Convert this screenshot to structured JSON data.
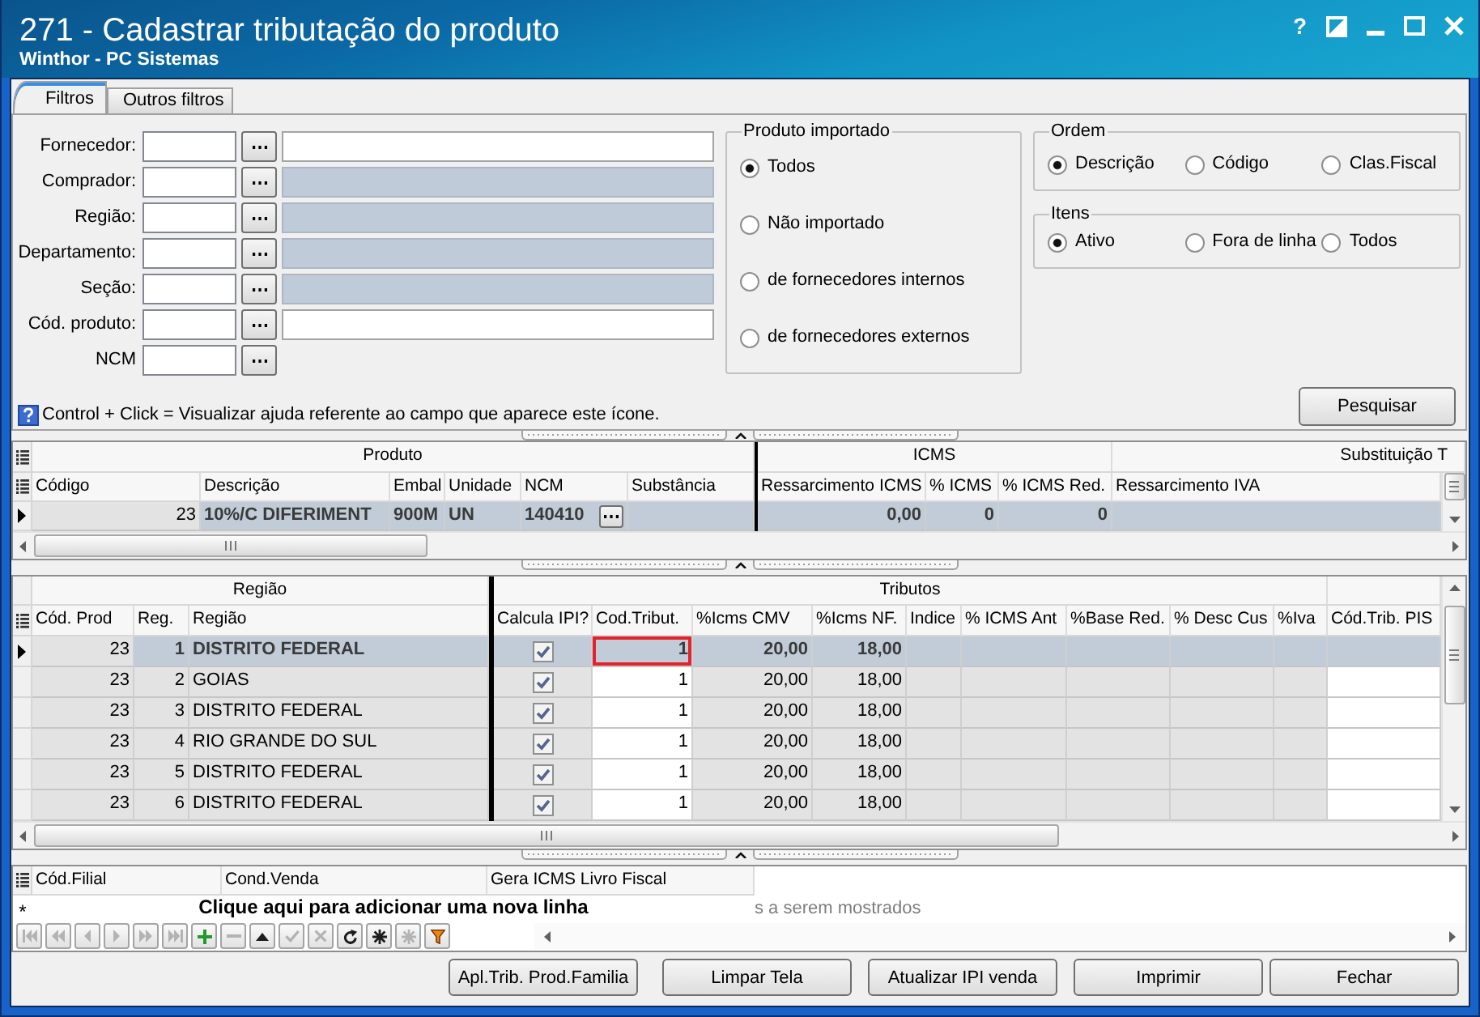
{
  "window": {
    "title": "271 - Cadastrar tributação do produto",
    "subtitle": "Winthor - PC Sistemas",
    "help_button": "?"
  },
  "tabs": [
    {
      "label": "Filtros",
      "selected": true
    },
    {
      "label": "Outros filtros",
      "selected": false
    }
  ],
  "filters": [
    {
      "label": "Fornecedor:",
      "kind": "lookup_description",
      "description_disabled": false
    },
    {
      "label": "Comprador:",
      "kind": "lookup_description",
      "description_disabled": true
    },
    {
      "label": "Região:",
      "kind": "lookup_description",
      "description_disabled": true
    },
    {
      "label": "Departamento:",
      "kind": "lookup_description",
      "description_disabled": true
    },
    {
      "label": "Seção:",
      "kind": "lookup_description",
      "description_disabled": true
    },
    {
      "label": "Cód. produto:",
      "kind": "lookup_description",
      "description_disabled": false
    },
    {
      "label": "NCM",
      "kind": "lookup"
    }
  ],
  "produto_importado": {
    "title": "Produto importado",
    "options": [
      {
        "label": "Todos",
        "selected": true
      },
      {
        "label": "Não importado",
        "selected": false
      },
      {
        "label": "de fornecedores internos",
        "selected": false
      },
      {
        "label": "de fornecedores externos",
        "selected": false
      }
    ]
  },
  "ordem": {
    "title": "Ordem",
    "options": [
      {
        "label": "Descrição",
        "selected": true
      },
      {
        "label": "Código",
        "selected": false
      },
      {
        "label": "Clas.Fiscal",
        "selected": false
      }
    ]
  },
  "itens": {
    "title": "Itens",
    "options": [
      {
        "label": "Ativo",
        "selected": true
      },
      {
        "label": "Fora de linha",
        "selected": false
      },
      {
        "label": "Todos",
        "selected": false
      }
    ]
  },
  "help_hint": "Control + Click = Visualizar ajuda referente ao campo que aparece este ícone.",
  "search_button": "Pesquisar",
  "product_grid": {
    "bands": [
      "Produto",
      "ICMS",
      "Substituição T"
    ],
    "columns": [
      "Código",
      "Descrição",
      "Embal",
      "Unidade",
      "NCM",
      "Substância",
      "Ressarcimento ICMS",
      "% ICMS",
      "% ICMS Red.",
      "Ressarcimento IVA"
    ],
    "rows": [
      {
        "selected": true,
        "codigo": "23",
        "descricao": "10%/C DIFERIMENT",
        "embalagem": "900M",
        "unidade": "UN",
        "ncm": "140410",
        "ressarcimento_icms": "0,00",
        "pct_icms": "0",
        "pct_icms_red": "0"
      }
    ]
  },
  "region_grid": {
    "bands": [
      "Região",
      "Tributos"
    ],
    "columns": [
      {
        "label": "Cód. Prod",
        "editable": false
      },
      {
        "label": "Reg.",
        "editable": false
      },
      {
        "label": "Região",
        "editable": false
      },
      {
        "label": "Calcula IPI?",
        "editable": false
      },
      {
        "label": "Cod.Tribut.",
        "editable": true
      },
      {
        "label": "%Icms CMV",
        "editable": false
      },
      {
        "label": "%Icms NF.",
        "editable": false
      },
      {
        "label": "Indice",
        "editable": false
      },
      {
        "label": "% ICMS Ant",
        "editable": false
      },
      {
        "label": "%Base Red.",
        "editable": false
      },
      {
        "label": "% Desc Cus",
        "editable": false
      },
      {
        "label": "%Iva",
        "editable": false
      },
      {
        "label": "Cód.Trib. PIS",
        "editable": true
      }
    ],
    "rows": [
      {
        "selected": true,
        "cod_prod": "23",
        "reg": "1",
        "regiao": "DISTRITO FEDERAL",
        "calcula_ipi_checked": true,
        "cod_tribut": "1",
        "cod_tribut_highlighted": true,
        "icms_cmv": "20,00",
        "icms_nf": "18,00"
      },
      {
        "selected": false,
        "cod_prod": "23",
        "reg": "2",
        "regiao": "GOIAS",
        "calcula_ipi_checked": true,
        "cod_tribut": "1",
        "cod_tribut_highlighted": false,
        "icms_cmv": "20,00",
        "icms_nf": "18,00"
      },
      {
        "selected": false,
        "cod_prod": "23",
        "reg": "3",
        "regiao": "DISTRITO FEDERAL",
        "calcula_ipi_checked": true,
        "cod_tribut": "1",
        "cod_tribut_highlighted": false,
        "icms_cmv": "20,00",
        "icms_nf": "18,00"
      },
      {
        "selected": false,
        "cod_prod": "23",
        "reg": "4",
        "regiao": "RIO GRANDE DO SUL",
        "calcula_ipi_checked": true,
        "cod_tribut": "1",
        "cod_tribut_highlighted": false,
        "icms_cmv": "20,00",
        "icms_nf": "18,00"
      },
      {
        "selected": false,
        "cod_prod": "23",
        "reg": "5",
        "regiao": "DISTRITO FEDERAL",
        "calcula_ipi_checked": true,
        "cod_tribut": "1",
        "cod_tribut_highlighted": false,
        "icms_cmv": "20,00",
        "icms_nf": "18,00"
      },
      {
        "selected": false,
        "cod_prod": "23",
        "reg": "6",
        "regiao": "DISTRITO FEDERAL",
        "calcula_ipi_checked": true,
        "cod_tribut": "1",
        "cod_tribut_highlighted": false,
        "icms_cmv": "20,00",
        "icms_nf": "18,00"
      }
    ]
  },
  "branch_grid": {
    "columns": [
      "Cód.Filial",
      "Cond.Venda",
      "Gera ICMS Livro Fiscal"
    ],
    "new_row_marker": "*",
    "new_row_prompt": "Clique aqui para adicionar uma nova linha",
    "empty_message": "s a serem mostrados",
    "navigator": [
      {
        "kind": "first",
        "disabled": true
      },
      {
        "kind": "prior_page",
        "disabled": true
      },
      {
        "kind": "prior",
        "disabled": true
      },
      {
        "kind": "next",
        "disabled": true
      },
      {
        "kind": "next_page",
        "disabled": true
      },
      {
        "kind": "last",
        "disabled": true
      },
      {
        "kind": "insert",
        "disabled": false
      },
      {
        "kind": "delete",
        "disabled": true
      },
      {
        "kind": "edit",
        "disabled": false
      },
      {
        "kind": "post",
        "disabled": true
      },
      {
        "kind": "cancel",
        "disabled": true
      },
      {
        "kind": "refresh",
        "disabled": false
      },
      {
        "kind": "save_bookmark",
        "disabled": false
      },
      {
        "kind": "goto_bookmark",
        "disabled": true
      },
      {
        "kind": "filter",
        "disabled": false
      }
    ]
  },
  "buttons": [
    "Apl.Trib. Prod.Familia",
    "Limpar Tela",
    "Atualizar IPI venda",
    "Imprimir",
    "Fechar"
  ]
}
